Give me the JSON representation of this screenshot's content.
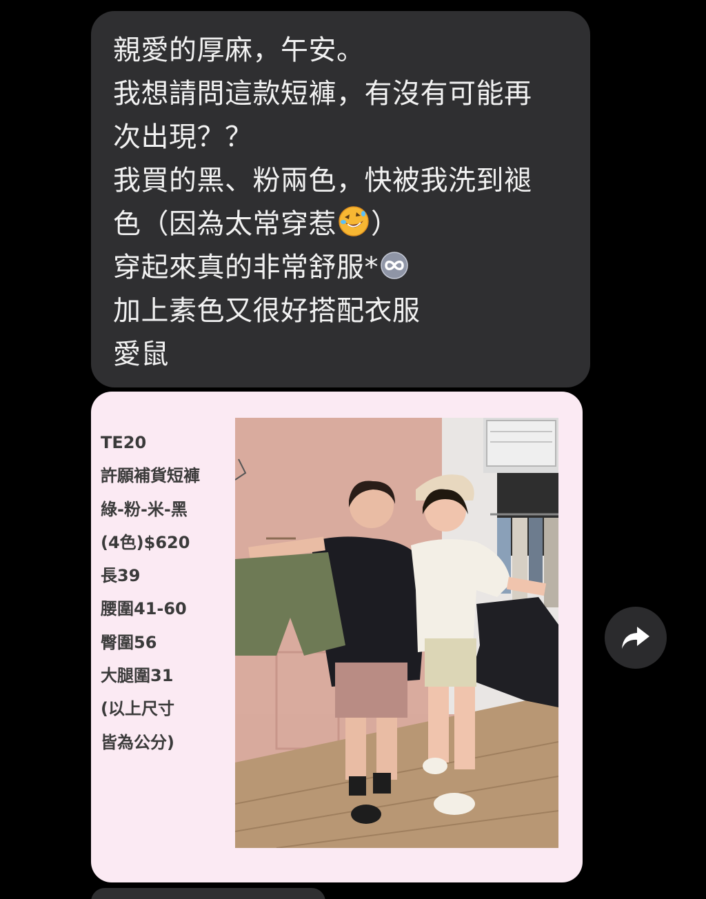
{
  "message": {
    "lines": [
      "親愛的厚麻，午安。",
      "我想請問這款短褲，有沒有可能再",
      "次出現？？",
      "我買的黑、粉兩色，快被我洗到褪",
      "色（因為太常穿惹",
      "）",
      "穿起來真的非常舒服*",
      "加上素色又很好搭配衣服",
      "愛鼠"
    ],
    "emojis": [
      "rolling-on-floor-laughing-icon",
      "infinity-icon"
    ]
  },
  "product_card": {
    "specs": [
      "TE20",
      "許願補貨短褲",
      "綠-粉-米-黑",
      "(4色)$620",
      "長39",
      "腰圍41-60",
      "臀圍56",
      "大腿圍31",
      "(以上尺寸",
      "皆為公分)"
    ]
  },
  "share_button": {
    "icon": "share-arrow-icon"
  },
  "colors": {
    "background": "#000000",
    "message_bubble": "#2f2f31",
    "message_text": "#f2f2f2",
    "card_background": "#fbeaf3",
    "spec_text": "#3a3a3a"
  }
}
